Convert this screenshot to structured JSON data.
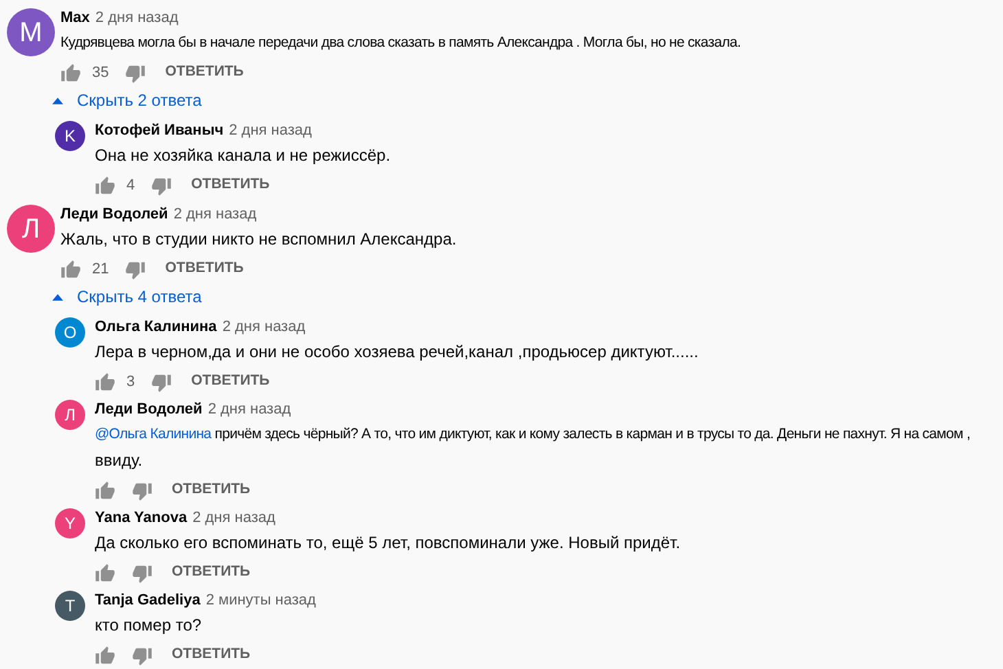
{
  "threads": [
    {
      "author": "Max",
      "time": "2 дня назад",
      "avatar": "M",
      "color": "#7e57c2",
      "lines": [
        "Кудрявцева могла бы в начале передачи два слова сказать в память Александра . Могла бы, но не сказала."
      ],
      "likes": "35",
      "reply": "ОТВЕТИТЬ",
      "toggle": {
        "label": "Скрыть 2 ответа",
        "expanded": true
      },
      "replies": [
        {
          "author": "Котофей Иваныч",
          "time": "2 дня назад",
          "avatar": "K",
          "color": "#512da8",
          "lines": [
            "Она не хозяйка канала и не режиссёр."
          ],
          "likes": "4",
          "reply": "ОТВЕТИТЬ"
        }
      ]
    },
    {
      "author": "Леди Водолей",
      "time": "2 дня назад",
      "avatar": "Л",
      "color": "#ec407a",
      "lines": [
        "Жаль, что в студии никто не вспомнил Александра."
      ],
      "likes": "21",
      "reply": "ОТВЕТИТЬ",
      "toggle": {
        "label": "Скрыть 4 ответа",
        "expanded": true
      },
      "replies": [
        {
          "author": "Ольга Калинина",
          "time": "2 дня назад",
          "avatar": "О",
          "color": "#0288d1",
          "lines": [
            "Лера в черном,да и они не особо хозяева  речей,канал ,продьюсер диктуют......"
          ],
          "likes": "3",
          "reply": "ОТВЕТИТЬ"
        },
        {
          "author": "Леди Водолей",
          "time": "2 дня назад",
          "avatar": "Л",
          "color": "#ec407a",
          "mention": "@Ольга Калинина",
          "lines": [
            "причём здесь чёрный? А то, что им диктуют, как и кому залесть в карман и в трусы то да. Деньги не пахнут. Я на самом ,",
            "ввиду."
          ],
          "reply": "ОТВЕТИТЬ"
        },
        {
          "author": "Yana Yanova",
          "time": "2 дня назад",
          "avatar": "Y",
          "color": "#ec407a",
          "lines": [
            "Да сколько его вспоминать то, ещё 5 лет, повспоминали уже. Новый придёт."
          ],
          "reply": "ОТВЕТИТЬ"
        },
        {
          "author": "Tanja Gadeliya",
          "time": "2 минуты назад",
          "avatar": "T",
          "color": "#455a64",
          "lines": [
            "кто помер то?"
          ],
          "reply": "ОТВЕТИТЬ"
        }
      ]
    }
  ]
}
